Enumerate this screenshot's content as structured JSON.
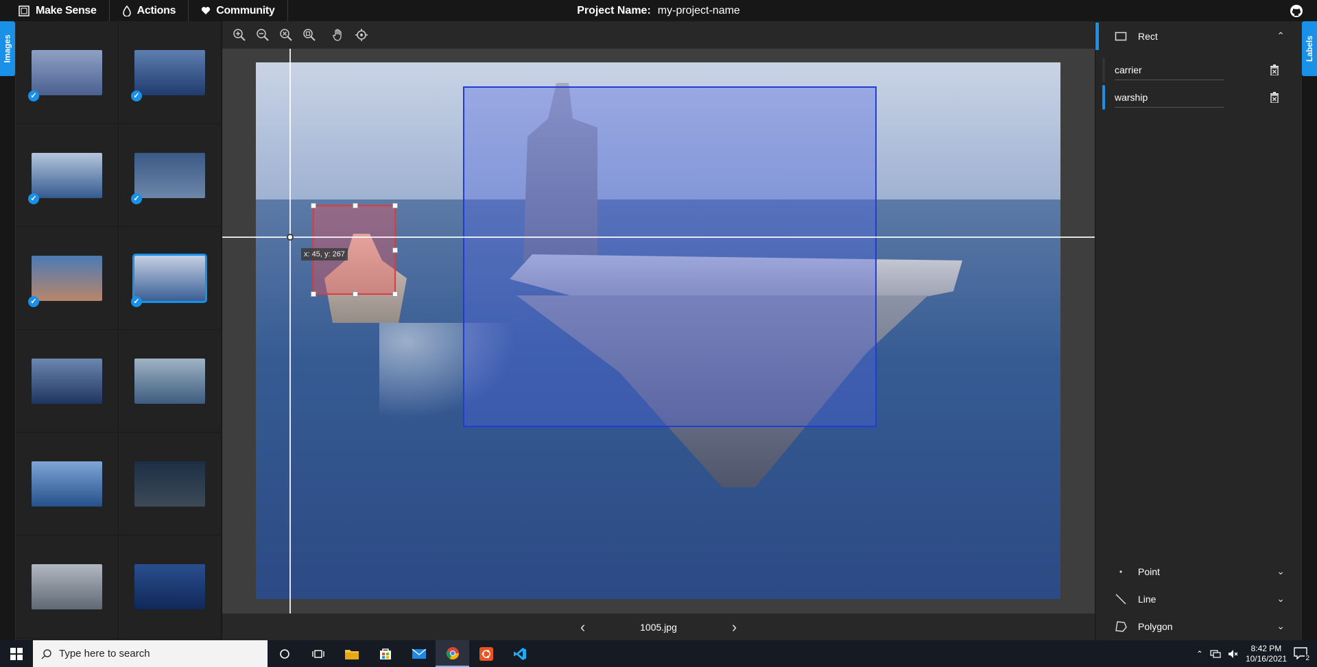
{
  "app": {
    "name": "Make Sense",
    "menu": [
      {
        "label": "Actions",
        "icon": "drop-icon"
      },
      {
        "label": "Community",
        "icon": "heart-icon"
      }
    ],
    "project_label": "Project Name:",
    "project_name": "my-project-name"
  },
  "left_panel": {
    "tab_label": "Images",
    "thumbnails": [
      {
        "colors": [
          "#8fa2c4",
          "#4a6090"
        ],
        "checked": true,
        "active": false
      },
      {
        "colors": [
          "#5d7fb0",
          "#203b6d"
        ],
        "checked": true,
        "active": false
      },
      {
        "colors": [
          "#b5c6dc",
          "#335b8f"
        ],
        "checked": true,
        "active": false
      },
      {
        "colors": [
          "#3a5a86",
          "#6d86a8"
        ],
        "checked": true,
        "active": false
      },
      {
        "colors": [
          "#4b7ab5",
          "#b8866a"
        ],
        "checked": true,
        "active": false
      },
      {
        "colors": [
          "#c5d0e4",
          "#3a5f95"
        ],
        "checked": true,
        "active": true
      },
      {
        "colors": [
          "#6c87b0",
          "#1f3561"
        ],
        "checked": false,
        "active": false
      },
      {
        "colors": [
          "#9fb3c4",
          "#3e5c7e"
        ],
        "checked": false,
        "active": false
      },
      {
        "colors": [
          "#7ea7d6",
          "#25508a"
        ],
        "checked": false,
        "active": false
      },
      {
        "colors": [
          "#1d2f46",
          "#3d4a57"
        ],
        "checked": false,
        "active": false
      },
      {
        "colors": [
          "#b2b8c1",
          "#5f6874"
        ],
        "checked": false,
        "active": false
      },
      {
        "colors": [
          "#2a4e8f",
          "#0f2858"
        ],
        "checked": false,
        "active": false
      }
    ]
  },
  "editor": {
    "tools": [
      {
        "name": "zoom-in-icon"
      },
      {
        "name": "zoom-out-icon"
      },
      {
        "name": "zoom-fit-icon"
      },
      {
        "name": "zoom-max-icon"
      },
      {
        "name": "hand-icon"
      },
      {
        "name": "crosshair-icon"
      }
    ],
    "cursor_coords": "x: 45, y: 267",
    "filename": "1005.jpg",
    "annotations": [
      {
        "label": "warship",
        "color": "#e03a3a"
      },
      {
        "label": "carrier",
        "color": "#1f3dd6"
      }
    ]
  },
  "right_panel": {
    "tab_label": "Labels",
    "rect_section": "Rect",
    "labels": [
      {
        "name": "carrier",
        "active": false
      },
      {
        "name": "warship",
        "active": true
      }
    ],
    "point_section": "Point",
    "line_section": "Line",
    "polygon_section": "Polygon"
  },
  "taskbar": {
    "search_placeholder": "Type here to search",
    "time": "8:42 PM",
    "date": "10/16/2021",
    "notification_count": "2"
  },
  "colors": {
    "accent": "#1991e8",
    "bg_dark": "#171717"
  }
}
